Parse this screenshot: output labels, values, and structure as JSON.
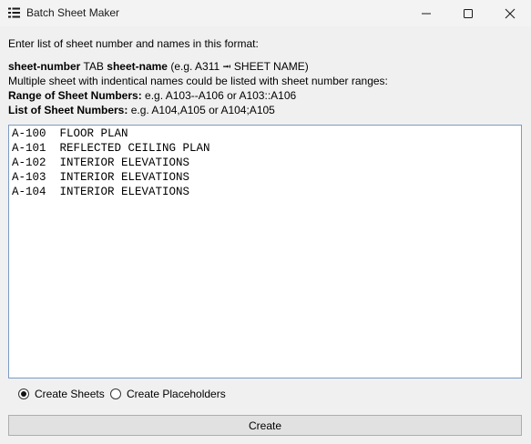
{
  "window": {
    "title": "Batch Sheet Maker",
    "icon": "list-icon",
    "controls": [
      "minimize-icon",
      "maximize-icon",
      "close-icon"
    ]
  },
  "instructions": {
    "line1": "Enter list of sheet number and names in this format:",
    "format": {
      "label_number": "sheet-number",
      "tab": "TAB",
      "label_name": "sheet-name",
      "example_prefix": "(e.g. A311",
      "tab_glyph": "⭲",
      "example_suffix": "SHEET NAME)"
    },
    "line3": "Multiple sheet with indentical names could be listed with sheet number ranges:",
    "range": {
      "label": "Range of Sheet Numbers:",
      "example": "e.g. A103--A106 or A103::A106"
    },
    "list": {
      "label": "List of Sheet Numbers:",
      "example": "e.g. A104,A105 or A104;A105"
    }
  },
  "editor": {
    "lines": [
      "A-100  FLOOR PLAN",
      "A-101  REFLECTED CEILING PLAN",
      "A-102  INTERIOR ELEVATIONS",
      "A-103  INTERIOR ELEVATIONS",
      "A-104  INTERIOR ELEVATIONS"
    ]
  },
  "options": {
    "create_sheets": {
      "label": "Create Sheets",
      "checked": true
    },
    "create_placeholders": {
      "label": "Create Placeholders",
      "checked": false
    }
  },
  "actions": {
    "create_label": "Create"
  }
}
